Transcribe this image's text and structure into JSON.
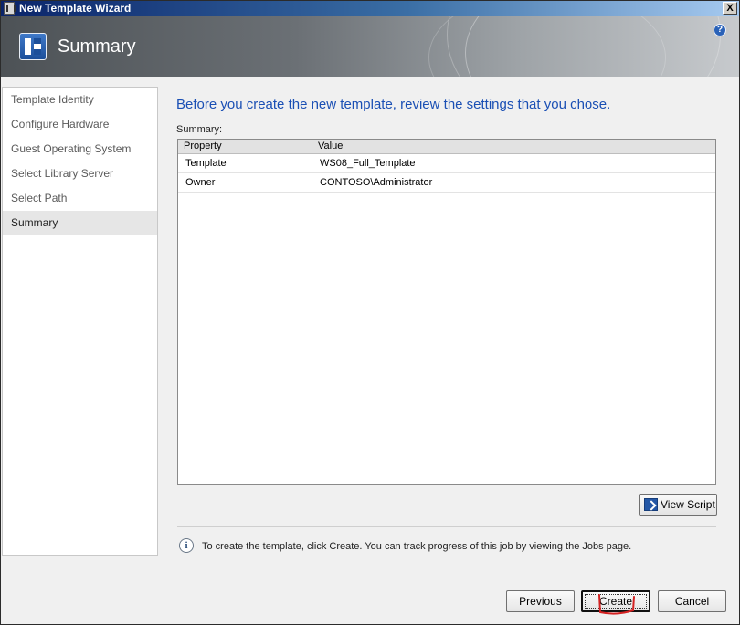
{
  "window": {
    "title": "New Template Wizard",
    "close_glyph": "X"
  },
  "header": {
    "title": "Summary",
    "help_glyph": "?"
  },
  "steps": [
    {
      "label": "Template Identity"
    },
    {
      "label": "Configure Hardware"
    },
    {
      "label": "Guest Operating System"
    },
    {
      "label": "Select Library Server"
    },
    {
      "label": "Select Path"
    },
    {
      "label": "Summary",
      "current": true
    }
  ],
  "content": {
    "headline": "Before you create the new template, review the settings that you chose.",
    "summary_label": "Summary:",
    "table": {
      "columns": [
        "Property",
        "Value"
      ],
      "rows": [
        {
          "property": "Template",
          "value": "WS08_Full_Template"
        },
        {
          "property": "Owner",
          "value": "CONTOSO\\Administrator"
        }
      ]
    },
    "view_script_label": "View Script",
    "info_glyph": "i",
    "info_text": "To create the template, click Create.  You can track progress of this job by viewing the Jobs page."
  },
  "buttons": {
    "previous": "Previous",
    "create": "Create",
    "cancel": "Cancel"
  },
  "colors": {
    "headline_blue": "#1a4fb4",
    "annotation_red": "#d42222"
  }
}
